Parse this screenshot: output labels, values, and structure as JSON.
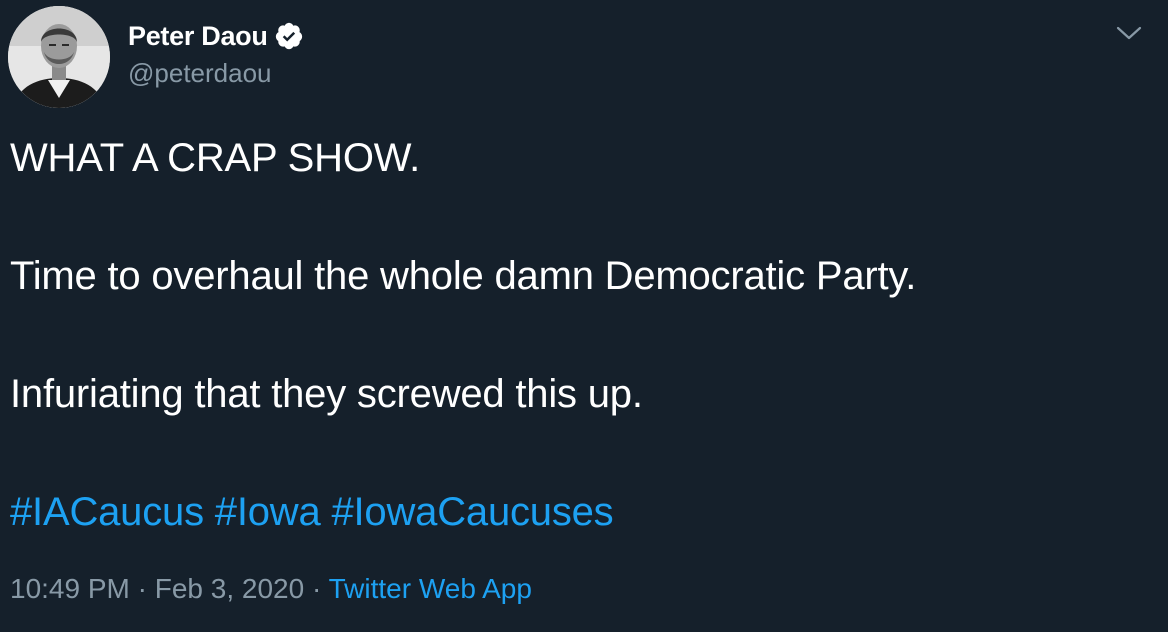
{
  "author": {
    "display_name": "Peter Daou",
    "handle": "@peterdaou",
    "verified": true,
    "avatar_icon": "profile-photo"
  },
  "tweet": {
    "lines": [
      "WHAT A CRAP SHOW.",
      "Time to overhaul the whole damn Democratic Party.",
      "Infuriating that they screwed this up."
    ],
    "hashtags": [
      "#IACaucus",
      "#Iowa",
      "#IowaCaucuses"
    ],
    "time": "10:49 PM",
    "separator": "·",
    "date": "Feb 3, 2020",
    "source": "Twitter Web App"
  },
  "colors": {
    "background": "#15202b",
    "text": "#ffffff",
    "muted": "#8899a6",
    "link": "#1da1f2"
  },
  "icons": {
    "verified": "verified-badge-icon",
    "menu": "chevron-down-icon"
  }
}
